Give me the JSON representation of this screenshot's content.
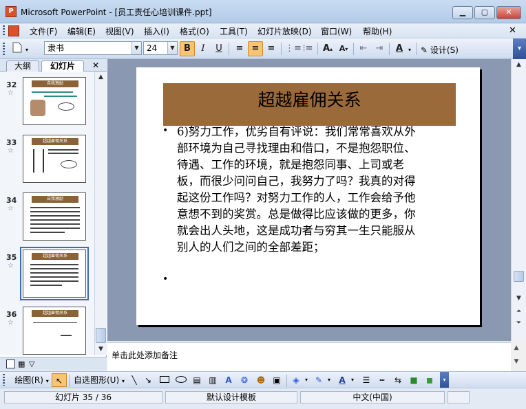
{
  "window": {
    "app_icon": "P",
    "title": "Microsoft PowerPoint - [员工责任心培训课件.ppt]",
    "controls": [
      "▁",
      "▢",
      "✕"
    ]
  },
  "menubar": {
    "items": [
      "文件(F)",
      "编辑(E)",
      "视图(V)",
      "插入(I)",
      "格式(O)",
      "工具(T)",
      "幻灯片放映(D)",
      "窗口(W)",
      "帮助(H)"
    ],
    "close_doc": "✕"
  },
  "toolbar": {
    "font_name": "隶书",
    "font_size": "24",
    "bold": "B",
    "italic": "I",
    "underline": "U",
    "design_label": "设计(S)"
  },
  "outline_pane": {
    "tabs": [
      "大纲",
      "幻灯片"
    ],
    "close": "✕",
    "slides": [
      {
        "number": "32",
        "title": "自我激励",
        "selected": false
      },
      {
        "number": "33",
        "title": "超越雇佣关系",
        "selected": false
      },
      {
        "number": "34",
        "title": "自我激励",
        "selected": false
      },
      {
        "number": "35",
        "title": "超越雇佣关系",
        "selected": true
      },
      {
        "number": "36",
        "title": "超越雇佣关系",
        "selected": false
      }
    ]
  },
  "slide": {
    "title": "超越雇佣关系",
    "body": "6)努力工作，优劣自有评说：我们常常喜欢从外部环境为自己寻找理由和借口，不是抱怨职位、待遇、工作的环境，就是抱怨同事、上司或老板，而很少问问自己，我努力了吗？我真的对得起这份工作吗？对努力工作的人，工作会给予他意想不到的奖赏。总是做得比应该做的更多，你就会出人头地，这是成功者与穷其一生只能服从别人的人们之间的全部差距；",
    "bullet": "•"
  },
  "notes": {
    "placeholder": "单击此处添加备注"
  },
  "draw_toolbar": {
    "draw_label": "绘图(R)",
    "autoshapes_label": "自选图形(U)"
  },
  "statusbar": {
    "slide_pos": "幻灯片 35 / 36",
    "template": "默认设计模板",
    "language": "中文(中国)"
  },
  "colors": {
    "title_fill": "#9b6a3b",
    "slide_bg": "#8a99b1",
    "selection": "#3f6ab5"
  }
}
